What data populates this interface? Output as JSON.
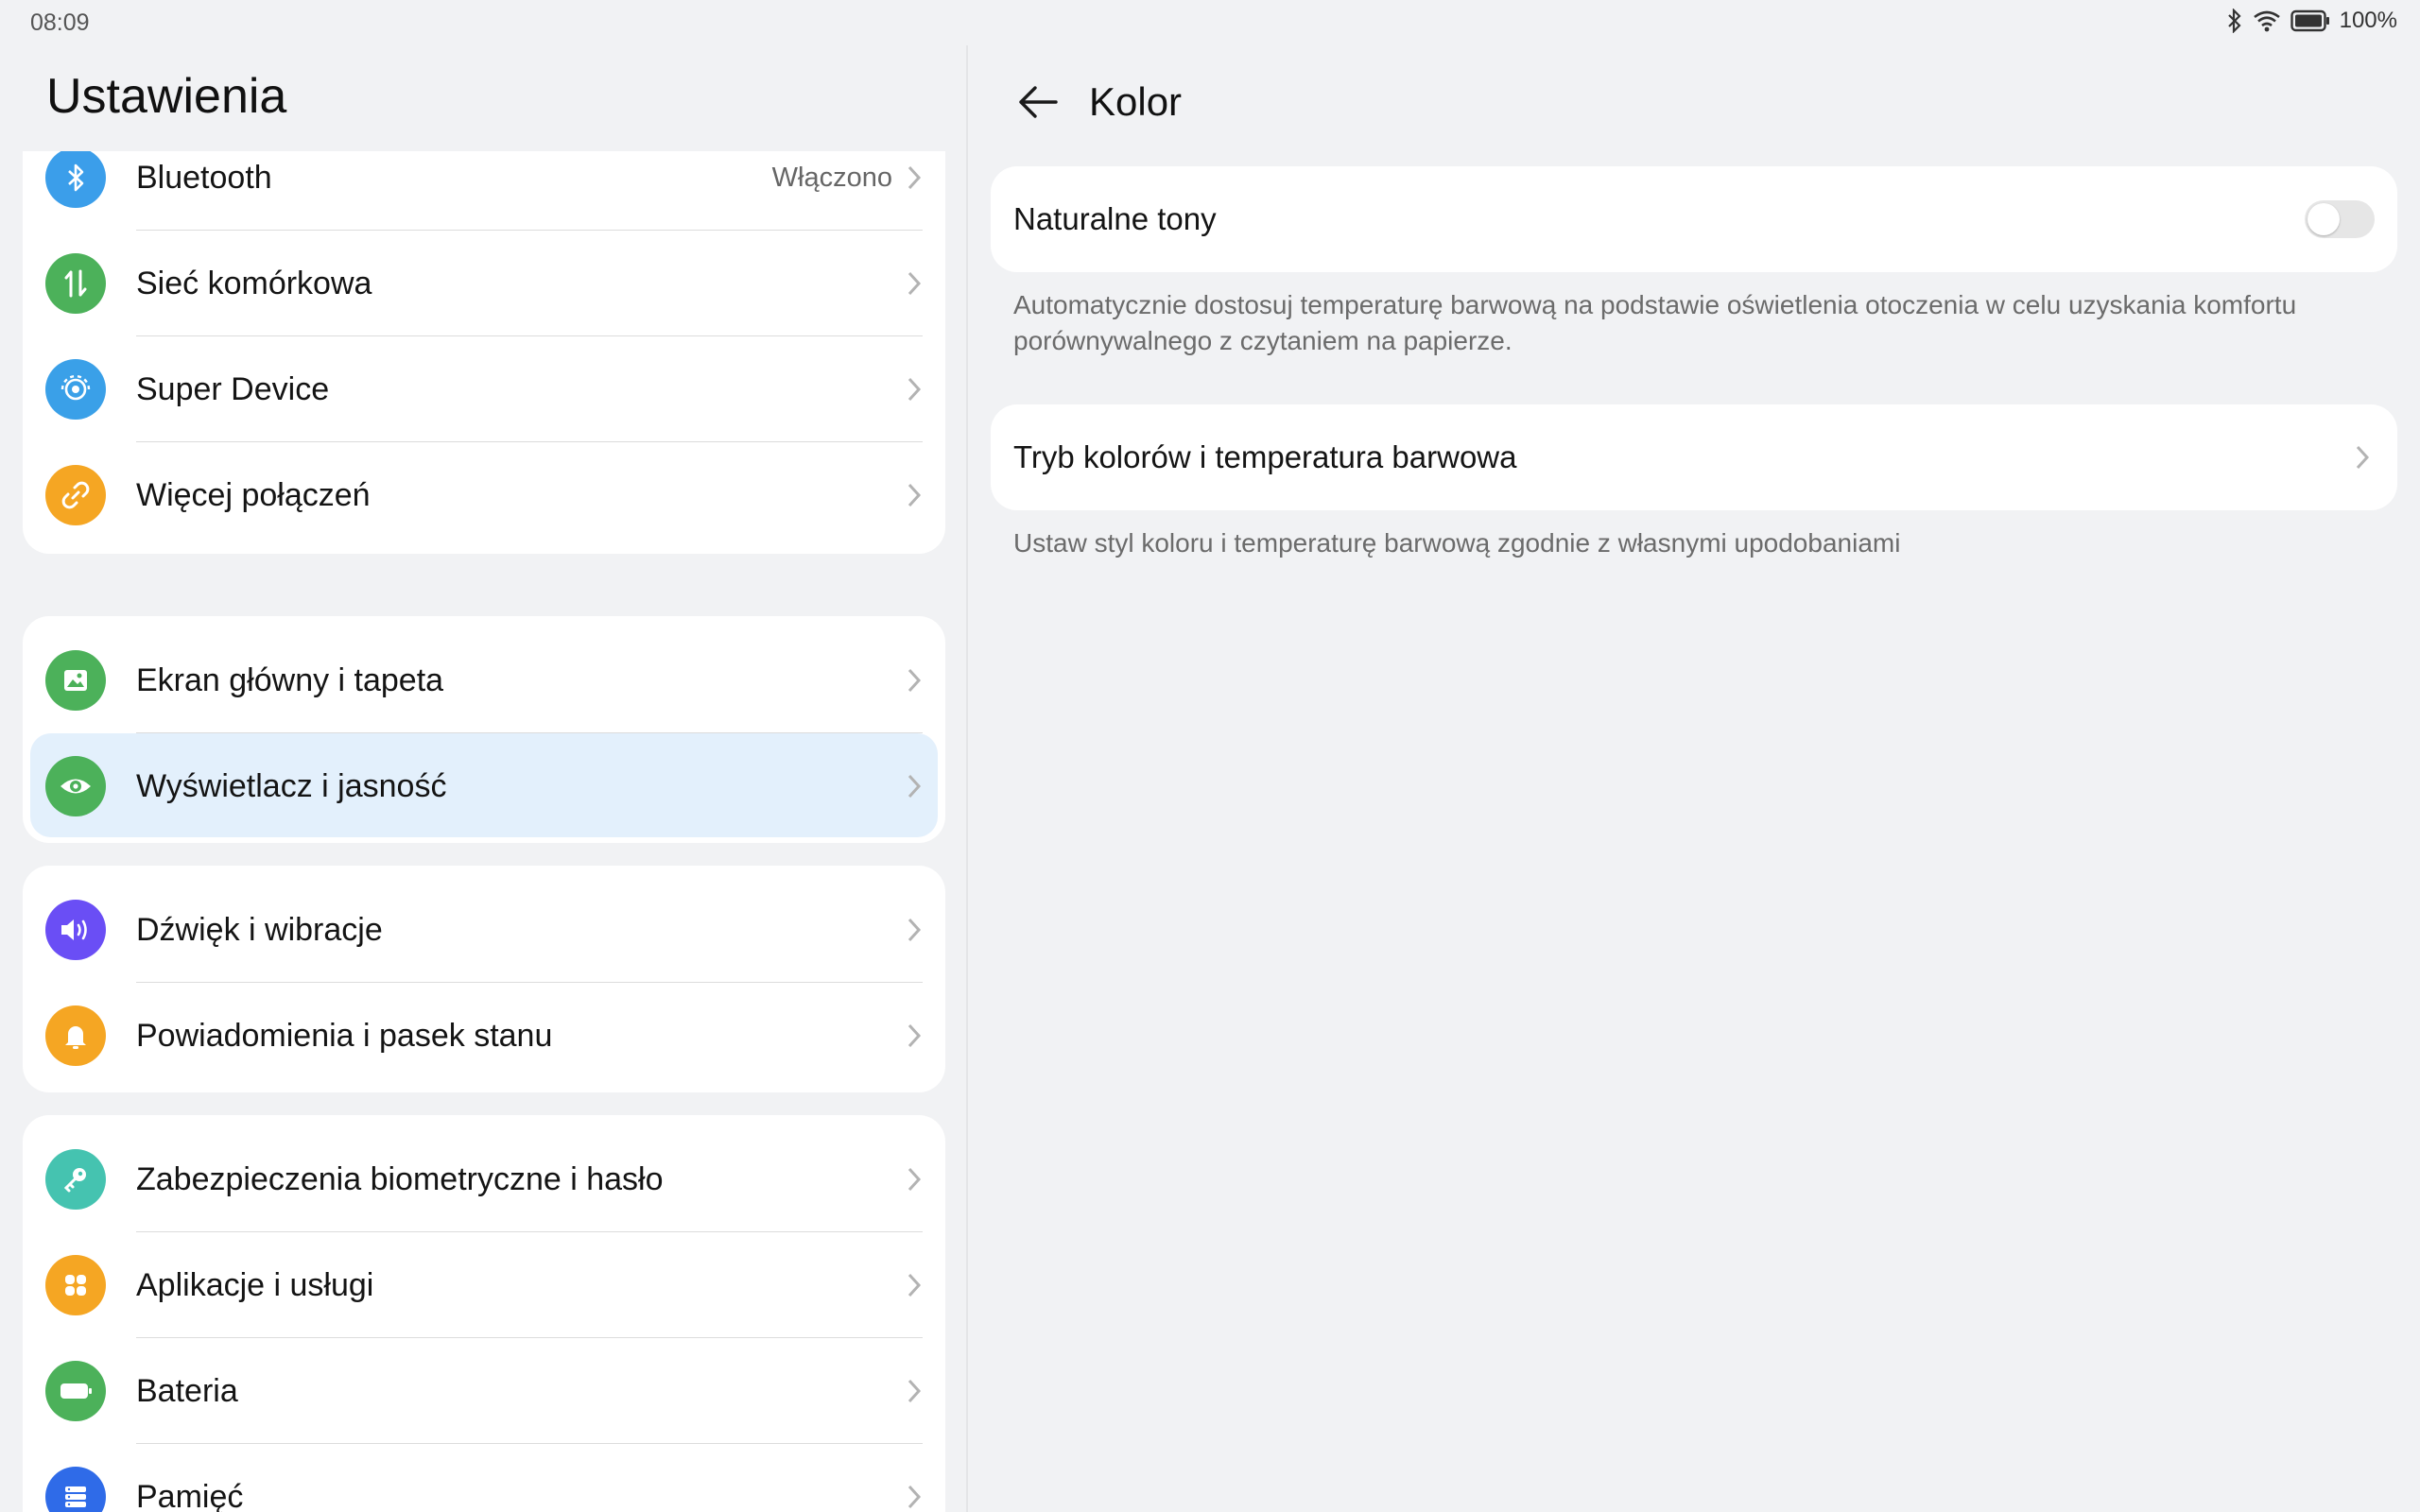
{
  "status_bar": {
    "time": "08:09",
    "battery": "100%"
  },
  "app_title": "Ustawienia",
  "left_list": {
    "groups": [
      {
        "items": [
          {
            "label": "Bluetooth",
            "value": "Włączono",
            "icon": "bluetooth-icon",
            "color": "#3b9eea"
          },
          {
            "label": "Sieć komórkowa",
            "icon": "mobile-data-icon",
            "color": "#4cb15a"
          },
          {
            "label": "Super Device",
            "icon": "super-device-icon",
            "color": "#3aa0e8"
          },
          {
            "label": "Więcej połączeń",
            "icon": "link-icon",
            "color": "#f5a623"
          }
        ]
      },
      {
        "items": [
          {
            "label": "Ekran główny i tapeta",
            "icon": "wallpaper-icon",
            "color": "#4cb15a"
          },
          {
            "label": "Wyświetlacz i jasność",
            "icon": "eye-icon",
            "color": "#4cb15a",
            "selected": true
          }
        ]
      },
      {
        "items": [
          {
            "label": "Dźwięk i wibracje",
            "icon": "sound-icon",
            "color": "#6a4ef5"
          },
          {
            "label": "Powiadomienia i pasek stanu",
            "icon": "bell-icon",
            "color": "#f5a623"
          }
        ]
      },
      {
        "items": [
          {
            "label": "Zabezpieczenia biometryczne i hasło",
            "icon": "key-icon",
            "color": "#45c3b0"
          },
          {
            "label": "Aplikacje i usługi",
            "icon": "apps-icon",
            "color": "#f5a623"
          },
          {
            "label": "Bateria",
            "icon": "battery-icon",
            "color": "#4cb15a"
          },
          {
            "label": "Pamięć",
            "icon": "storage-icon",
            "color": "#2f6be8"
          }
        ]
      }
    ]
  },
  "detail": {
    "title": "Kolor",
    "natural_tones": {
      "label": "Naturalne tony",
      "enabled": false,
      "description": "Automatycznie dostosuj temperaturę barwową na podstawie oświetlenia otoczenia w celu uzyskania komfortu porównywalnego z czytaniem na papierze."
    },
    "color_mode": {
      "label": "Tryb kolorów i temperatura barwowa",
      "description": "Ustaw styl koloru i temperaturę barwową zgodnie z własnymi upodobaniami"
    }
  }
}
